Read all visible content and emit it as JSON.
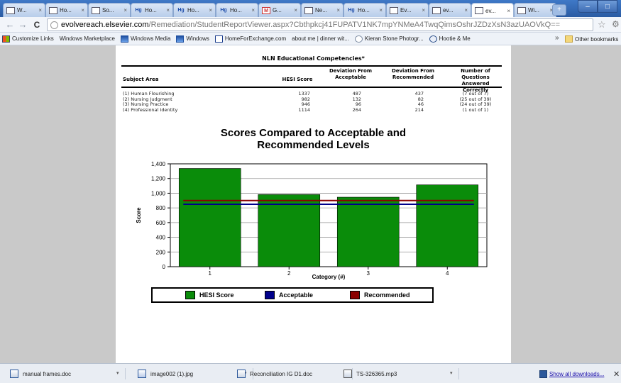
{
  "browser": {
    "tabs": [
      {
        "label": "W...",
        "icon": "page-icon",
        "active": false
      },
      {
        "label": "Ho...",
        "icon": "page-icon",
        "active": false
      },
      {
        "label": "So...",
        "icon": "page-icon",
        "active": false
      },
      {
        "label": "Ho...",
        "icon": "hg-icon",
        "active": false
      },
      {
        "label": "Ho...",
        "icon": "hg-icon",
        "active": false
      },
      {
        "label": "Ho...",
        "icon": "hg-icon",
        "active": false
      },
      {
        "label": "G...",
        "icon": "gmail-icon",
        "active": false
      },
      {
        "label": "Ne...",
        "icon": "page-icon",
        "active": false
      },
      {
        "label": "Ho...",
        "icon": "hg-icon",
        "active": false
      },
      {
        "label": "Ev...",
        "icon": "page-icon",
        "active": false
      },
      {
        "label": "ev...",
        "icon": "page-icon",
        "active": false
      },
      {
        "label": "ev...",
        "icon": "page-icon",
        "active": true
      },
      {
        "label": "Wi...",
        "icon": "page-icon",
        "active": false
      }
    ],
    "url_host": "evolvereach.elsevier.com",
    "url_path": "/Remediation/StudentReportViewer.aspx?Cbthpkcj41FUPATV1NK7mpYNMeA4TwqQimsOshrJZDzXsN3azUAOVkQ==",
    "bookmarks": [
      {
        "label": "Customize Links",
        "icon": "ms"
      },
      {
        "label": "Windows Marketplace",
        "icon": "page"
      },
      {
        "label": "Windows Media",
        "icon": "wm"
      },
      {
        "label": "Windows",
        "icon": "wm"
      },
      {
        "label": "HomeForExchange.com",
        "icon": "hfe"
      },
      {
        "label": "about me | dinner wit...",
        "icon": "page"
      },
      {
        "label": "Kieran Stone Photogr...",
        "icon": "ks"
      },
      {
        "label": "Hootie & Me",
        "icon": "hh"
      }
    ],
    "bookmarks_overflow": "»",
    "other_bookmarks": "Other bookmarks"
  },
  "report": {
    "competencies_title": "NLN Educational Competencies*",
    "columns": {
      "subject": "Subject Area",
      "hesi": "HESI Score",
      "dev_acc": "Deviation From Acceptable",
      "dev_rec": "Deviation From Recommended",
      "num_correct": "Number of Questions Answered Correctly"
    },
    "rows": [
      {
        "subject": "(1) Human Flourishing",
        "hesi": "1337",
        "dev_acc": "487",
        "dev_rec": "437",
        "num_correct": "(7 out of 7)"
      },
      {
        "subject": "(2) Nursing Judgment",
        "hesi": "982",
        "dev_acc": "132",
        "dev_rec": "82",
        "num_correct": "(25 out of 39)"
      },
      {
        "subject": "(3) Nursing Practice",
        "hesi": "946",
        "dev_acc": "96",
        "dev_rec": "46",
        "num_correct": "(24 out of 39)"
      },
      {
        "subject": "(4) Professional Identity",
        "hesi": "1114",
        "dev_acc": "264",
        "dev_rec": "214",
        "num_correct": "(1 out of 1)"
      }
    ],
    "chart_title_line1": "Scores Compared to Acceptable and",
    "chart_title_line2": "Recommended Levels"
  },
  "chart_data": {
    "type": "bar",
    "title": "Scores Compared to Acceptable and Recommended Levels",
    "xlabel": "Category (#)",
    "ylabel": "Score",
    "categories": [
      "1",
      "2",
      "3",
      "4"
    ],
    "ylim": [
      0,
      1400
    ],
    "yticks": [
      "0",
      "200",
      "400",
      "600",
      "800",
      "1,000",
      "1,200",
      "1,400"
    ],
    "grid": true,
    "legend_position": "bottom",
    "series": [
      {
        "name": "HESI Score",
        "type": "bar",
        "values": [
          1337,
          982,
          946,
          1114
        ],
        "color": "#0a8c0a"
      },
      {
        "name": "Acceptable",
        "type": "line",
        "values": [
          850,
          850,
          850,
          850
        ],
        "color": "#00008b"
      },
      {
        "name": "Recommended",
        "type": "line",
        "values": [
          900,
          900,
          900,
          900
        ],
        "color": "#8b0000"
      }
    ]
  },
  "downloads": {
    "items": [
      {
        "name": "manual frames.doc",
        "icon": "doc"
      },
      {
        "name": "image002 (1).jpg",
        "icon": "img"
      },
      {
        "name": "Reconciliation IG D1.doc",
        "icon": "doc"
      },
      {
        "name": "TS-326365.mp3",
        "icon": "mp3"
      }
    ],
    "show_all": "Show all downloads..."
  },
  "colors": {
    "tabstrip": "#2a5ba3",
    "page_bg": "#c9c9c9",
    "bar_green": "#0a8c0a",
    "acceptable": "#00008b",
    "recommended": "#8b0000"
  }
}
